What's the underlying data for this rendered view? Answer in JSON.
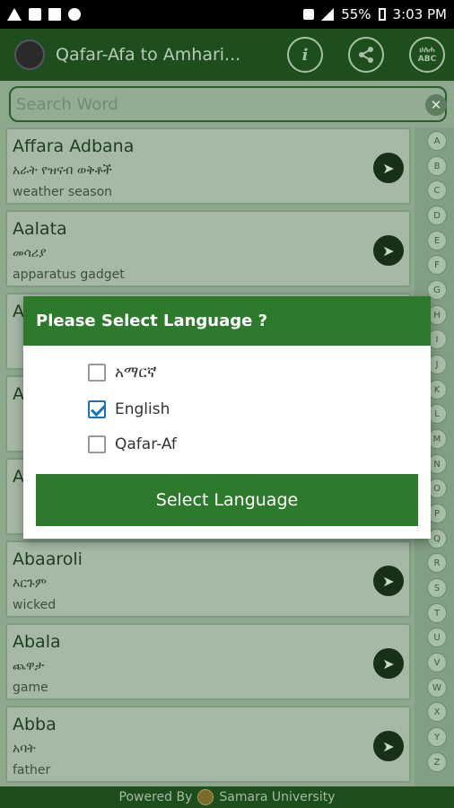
{
  "status_bar": {
    "icons": [
      "warning-icon",
      "folder-icon",
      "image-icon",
      "settings-icon"
    ],
    "battery": "55%",
    "time": "3:03 PM"
  },
  "app_bar": {
    "title": "Qafar-Afa to Amhari...",
    "buttons": [
      "info-icon",
      "share-icon",
      "alphabet-icon"
    ],
    "alphabet_icon_text": [
      "ሀለሐ",
      "ABC"
    ]
  },
  "search": {
    "placeholder": "Search Word",
    "clear": "✕"
  },
  "entries": [
    {
      "word": "Affara Adbana",
      "amharic": "አራት የዝናብ ወቅቶች",
      "english": "weather season"
    },
    {
      "word": "Aalata",
      "amharic": "መሳሪያ",
      "english": "apparatus gadget"
    },
    {
      "word": "A",
      "amharic": "",
      "english": ""
    },
    {
      "word": "A",
      "amharic": "",
      "english": ""
    },
    {
      "word": "A",
      "amharic": "",
      "english": ""
    },
    {
      "word": "Abaaroli",
      "amharic": "እርጉም",
      "english": "wicked"
    },
    {
      "word": "Abala",
      "amharic": "ጨዋታ",
      "english": "game"
    },
    {
      "word": "Abba",
      "amharic": "አባት",
      "english": "father"
    }
  ],
  "alphabet": [
    "A",
    "B",
    "C",
    "D",
    "E",
    "F",
    "G",
    "H",
    "I",
    "J",
    "K",
    "L",
    "M",
    "N",
    "O",
    "P",
    "Q",
    "R",
    "S",
    "T",
    "U",
    "V",
    "W",
    "X",
    "Y",
    "Z"
  ],
  "footer": {
    "powered_by": "Powered By",
    "org": "Samara University"
  },
  "dialog": {
    "title": "Please Select Language ?",
    "options": [
      {
        "label": "አማርኛ",
        "checked": false
      },
      {
        "label": "English",
        "checked": true
      },
      {
        "label": "Qafar-Af",
        "checked": false
      }
    ],
    "button": "Select Language"
  },
  "colors": {
    "primary": "#2d7a2d",
    "dark_bar": "#1e4d1e",
    "check": "#1a73b8"
  }
}
